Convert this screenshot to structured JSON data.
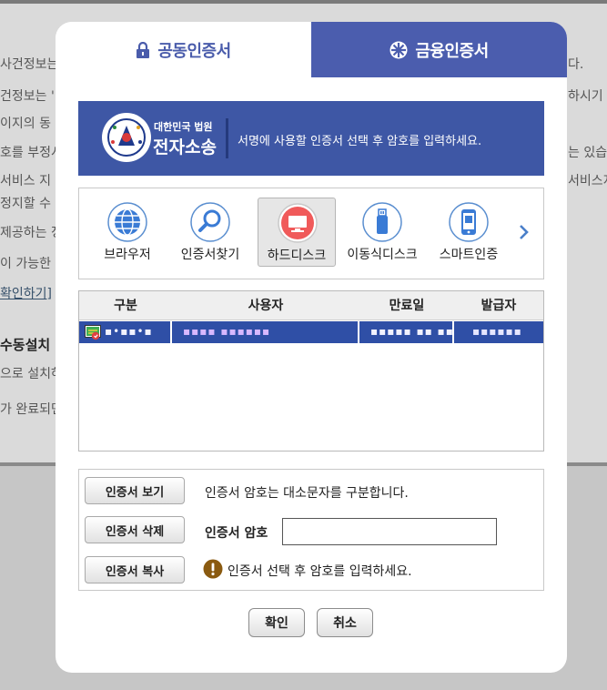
{
  "background": {
    "lines": [
      "사건정보는",
      "건정보는 '",
      "이지의 동",
      "호를 부정시",
      "서비스 지",
      "정지할 수",
      "제공하는 정",
      "이 가능한"
    ],
    "right_lines": [
      "다.",
      "하시기 바",
      "는 있습니",
      "서비스지"
    ],
    "link": "확인하기]",
    "heading": "수동설치",
    "lower_lines": [
      "으로 설치하",
      "가 완료되면"
    ]
  },
  "dialog": {
    "tabs": [
      {
        "label": "공동인증서",
        "icon": "lock-icon",
        "active": true
      },
      {
        "label": "금융인증서",
        "icon": "finance-cert-icon",
        "active": false
      }
    ],
    "banner": {
      "logo_top": "대한민국 법원",
      "logo_main": "전자소송",
      "message": "서명에 사용할 인증서 선택 후 암호를 입력하세요."
    },
    "storage": [
      {
        "label": "브라우저",
        "icon": "globe-icon",
        "selected": false
      },
      {
        "label": "인증서찾기",
        "icon": "search-icon",
        "selected": false
      },
      {
        "label": "하드디스크",
        "icon": "monitor-icon",
        "selected": true
      },
      {
        "label": "이동식디스크",
        "icon": "usb-icon",
        "selected": false
      },
      {
        "label": "스마트인증",
        "icon": "smartphone-icon",
        "selected": false
      }
    ],
    "table": {
      "headers": [
        "구분",
        "사용자",
        "만료일",
        "발급자"
      ],
      "rows": [
        {
          "type": "▪•▪▪•▪",
          "user": "▪▪▪▪ ▪▪▪▪▪▪",
          "expiry": "▪▪▪▪▪ ▪▪ ▪▪",
          "issuer": "▪▪▪▪▪▪"
        }
      ]
    },
    "actions": {
      "view": "인증서 보기",
      "delete": "인증서 삭제",
      "copy": "인증서 복사",
      "case_note": "인증서 암호는 대소문자를 구분합니다.",
      "password_label": "인증서 암호",
      "password_value": "",
      "warning": "인증서 선택 후 암호를 입력하세요."
    },
    "footer": {
      "confirm": "확인",
      "cancel": "취소"
    }
  },
  "colors": {
    "primary_blue": "#4b5dae",
    "banner_blue": "#3e57a5",
    "selected_row": "#2f4fa6",
    "harddisk_red": "#f05a5a",
    "warn_brown": "#8a5a10"
  }
}
